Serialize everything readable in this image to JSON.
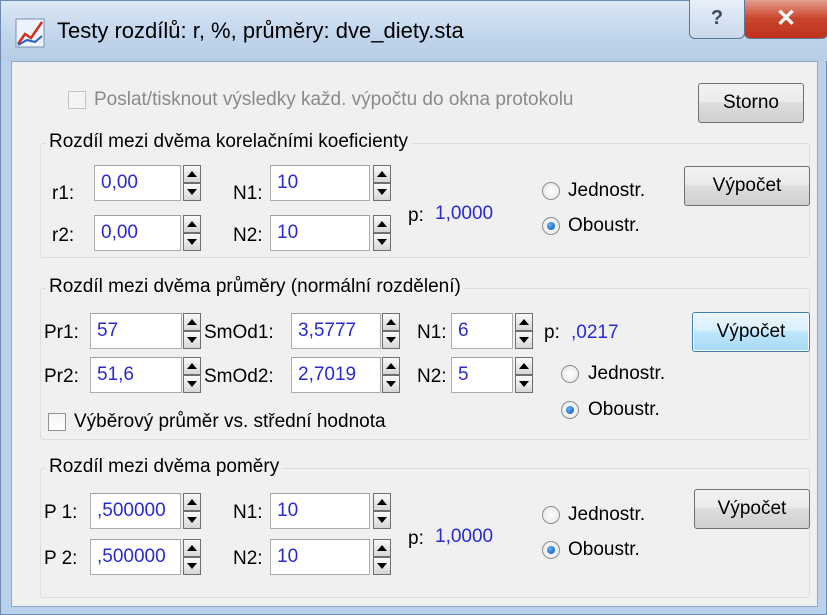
{
  "window": {
    "title": "Testy rozdílů: r, %, průměry: dve_diety.sta",
    "icon": "chart-icon",
    "help_glyph": "?",
    "close_glyph": "✕"
  },
  "top": {
    "send_checkbox_label": "Poslat/tisknout výsledky každ. výpočtu do okna protokolu",
    "send_checked": false,
    "cancel_label": "Storno"
  },
  "corr": {
    "legend": "Rozdíl mezi dvěma korelačními koeficienty",
    "r1_label": "r1:",
    "r1_value": "0,00",
    "r2_label": "r2:",
    "r2_value": "0,00",
    "n1_label": "N1:",
    "n1_value": "10",
    "n2_label": "N2:",
    "n2_value": "10",
    "p_label": "p:",
    "p_value": "1,0000",
    "one_sided_label": "Jednostr.",
    "two_sided_label": "Oboustr.",
    "selected": "Oboustr.",
    "compute_label": "Výpočet"
  },
  "means": {
    "legend": "Rozdíl mezi dvěma průměry (normální rozdělení)",
    "pr1_label": "Pr1:",
    "pr1_value": "57",
    "pr2_label": "Pr2:",
    "pr2_value": "51,6",
    "sd1_label": "SmOd1:",
    "sd1_value": "3,5777",
    "sd2_label": "SmOd2:",
    "sd2_value": "2,7019",
    "n1_label": "N1:",
    "n1_value": "6",
    "n2_label": "N2:",
    "n2_value": "5",
    "p_label": "p:",
    "p_value": ",0217",
    "one_sided_label": "Jednostr.",
    "two_sided_label": "Oboustr.",
    "selected": "Oboustr.",
    "compute_label": "Výpočet",
    "sample_vs_mean_label": "Výběrový průměr vs. střední hodnota",
    "sample_vs_mean_checked": false
  },
  "props": {
    "legend": "Rozdíl mezi dvěma poměry",
    "p1_label": "P 1:",
    "p1_value": ",500000",
    "p2_label": "P 2:",
    "p2_value": ",500000",
    "n1_label": "N1:",
    "n1_value": "10",
    "n2_label": "N2:",
    "n2_value": "10",
    "p_label": "p:",
    "p_value": "1,0000",
    "one_sided_label": "Jednostr.",
    "two_sided_label": "Oboustr.",
    "selected": "Oboustr.",
    "compute_label": "Výpočet"
  },
  "colors": {
    "value_text": "#2a2ad0",
    "window_frame": "#b9d1ea",
    "close_button": "#c9462e"
  }
}
